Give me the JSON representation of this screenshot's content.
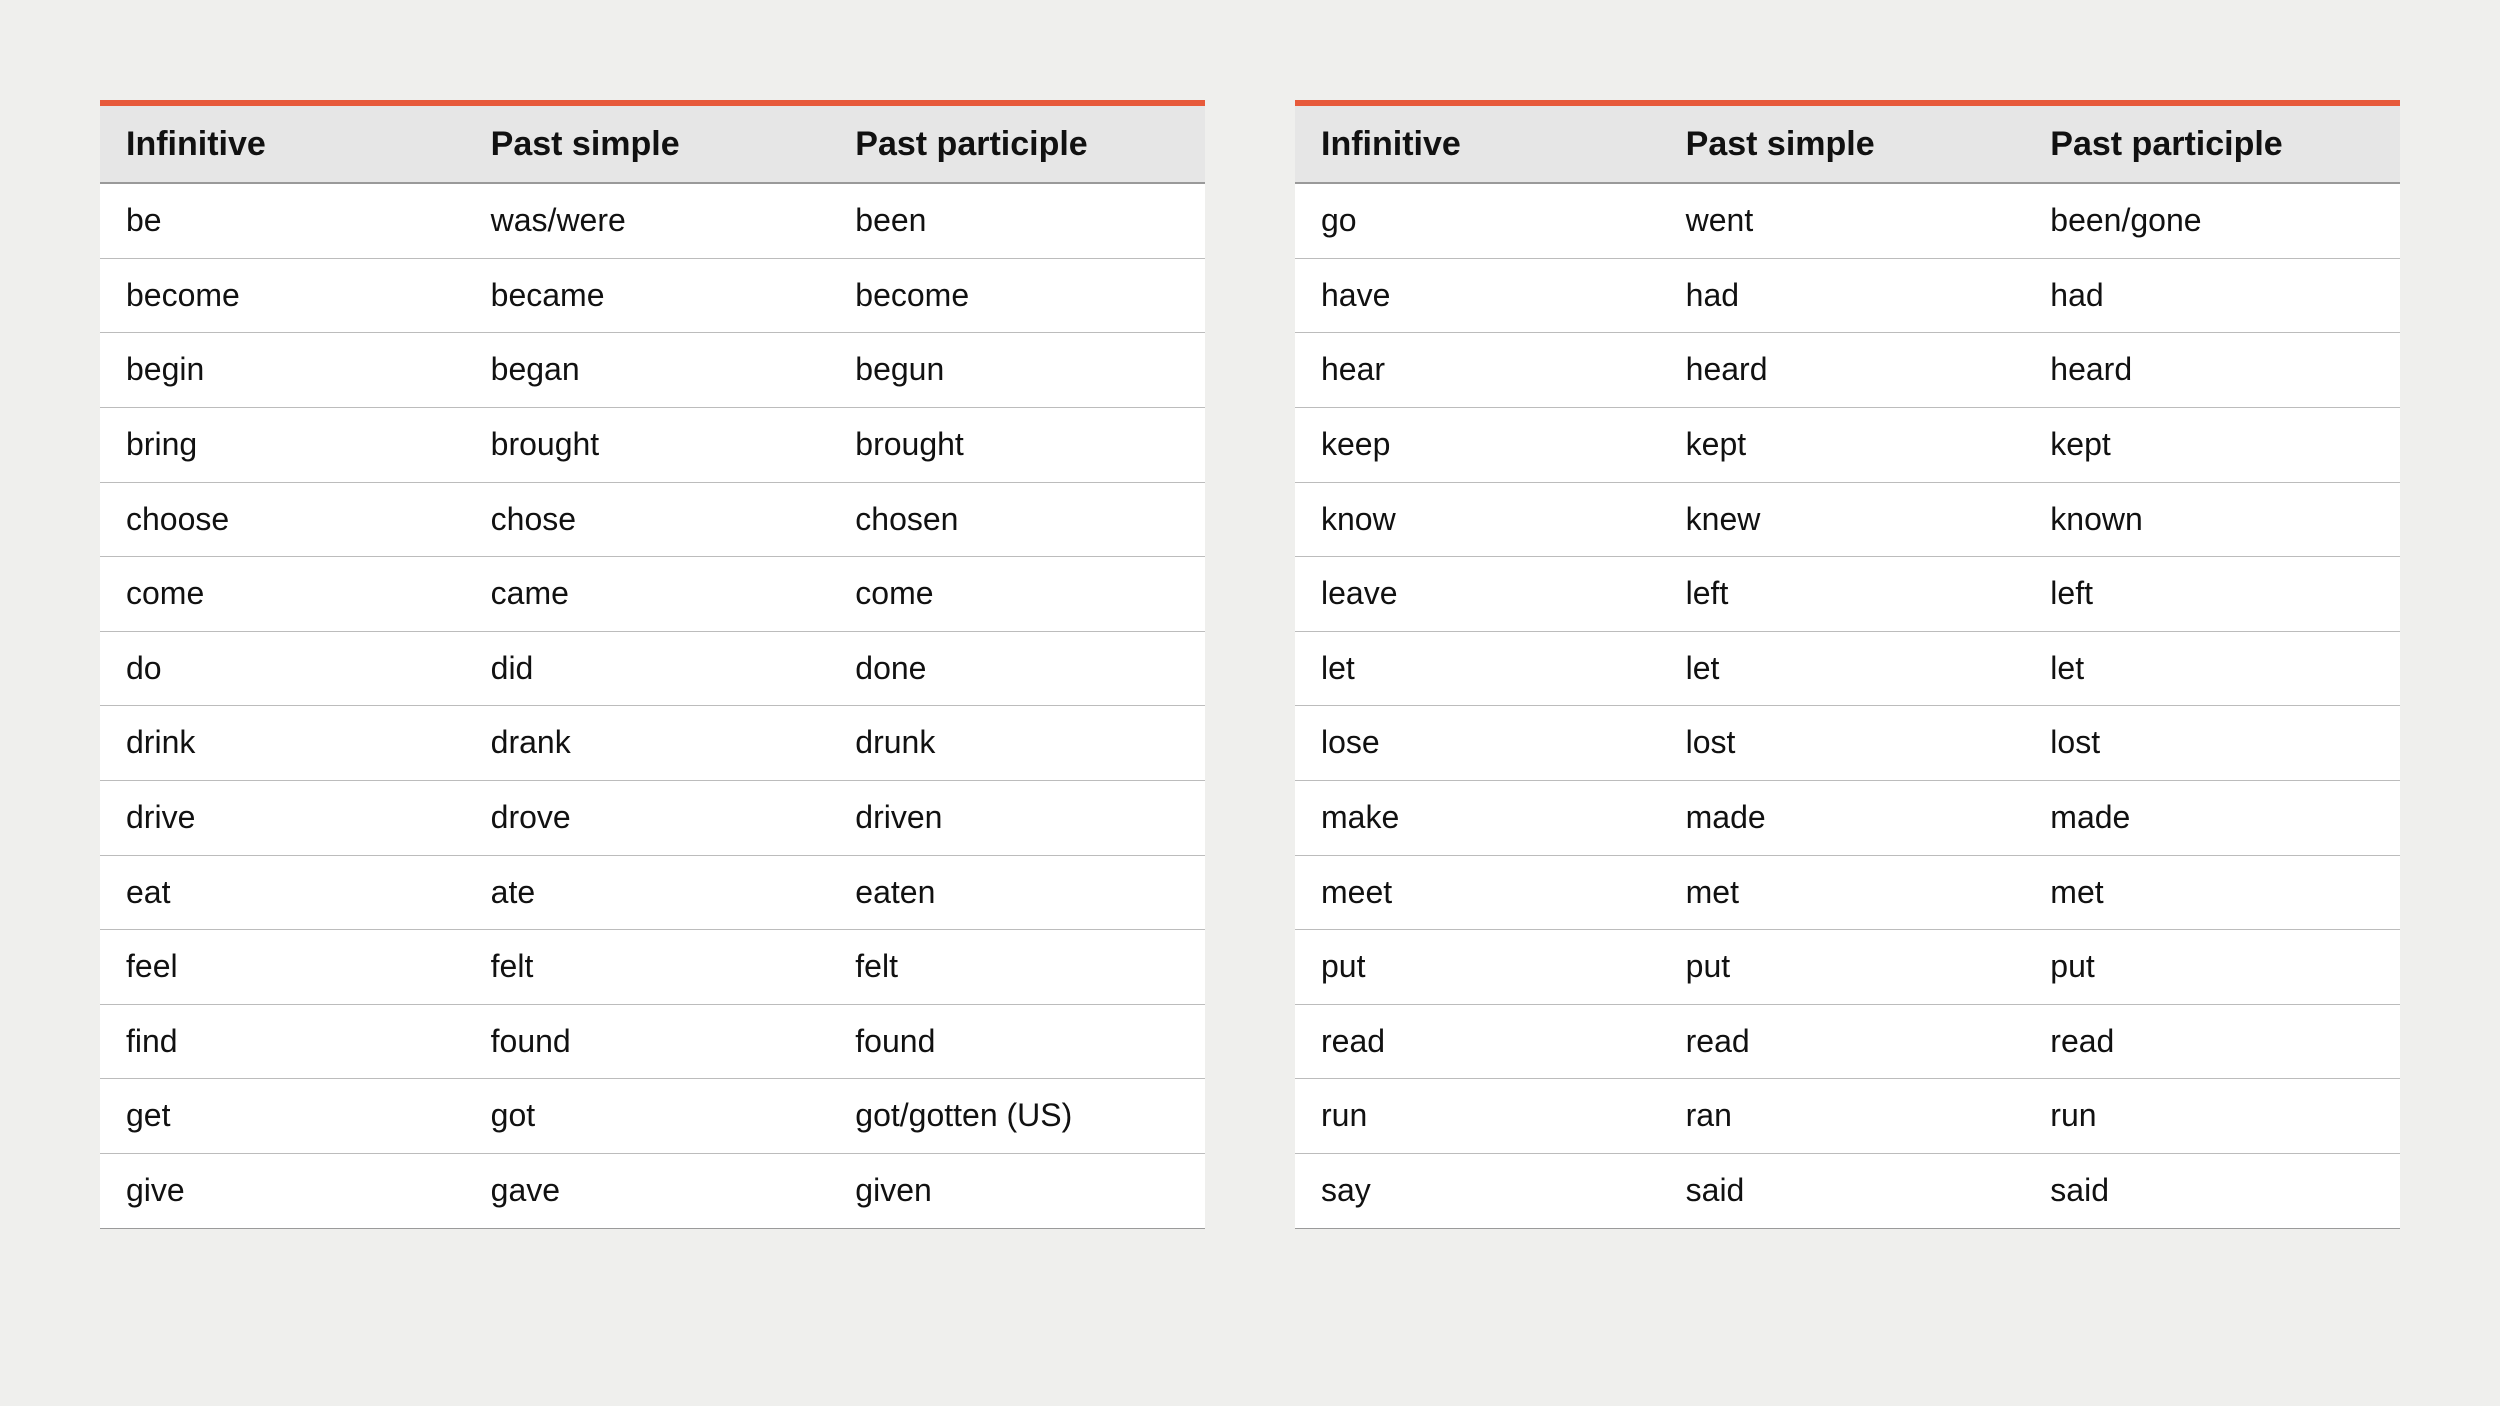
{
  "headers": {
    "infinitive": "Infinitive",
    "past_simple": "Past simple",
    "past_participle": "Past participle"
  },
  "tables": [
    {
      "rows": [
        {
          "infinitive": "be",
          "past_simple": "was/were",
          "past_participle": "been"
        },
        {
          "infinitive": "become",
          "past_simple": "became",
          "past_participle": "become"
        },
        {
          "infinitive": "begin",
          "past_simple": "began",
          "past_participle": "begun"
        },
        {
          "infinitive": "bring",
          "past_simple": "brought",
          "past_participle": "brought"
        },
        {
          "infinitive": "choose",
          "past_simple": "chose",
          "past_participle": "chosen"
        },
        {
          "infinitive": "come",
          "past_simple": "came",
          "past_participle": "come"
        },
        {
          "infinitive": "do",
          "past_simple": "did",
          "past_participle": "done"
        },
        {
          "infinitive": "drink",
          "past_simple": "drank",
          "past_participle": "drunk"
        },
        {
          "infinitive": "drive",
          "past_simple": "drove",
          "past_participle": "driven"
        },
        {
          "infinitive": "eat",
          "past_simple": "ate",
          "past_participle": "eaten"
        },
        {
          "infinitive": "feel",
          "past_simple": "felt",
          "past_participle": "felt"
        },
        {
          "infinitive": "find",
          "past_simple": "found",
          "past_participle": "found"
        },
        {
          "infinitive": "get",
          "past_simple": "got",
          "past_participle": "got/gotten (US)"
        },
        {
          "infinitive": "give",
          "past_simple": "gave",
          "past_participle": "given"
        }
      ]
    },
    {
      "rows": [
        {
          "infinitive": "go",
          "past_simple": "went",
          "past_participle": "been/gone"
        },
        {
          "infinitive": "have",
          "past_simple": "had",
          "past_participle": "had"
        },
        {
          "infinitive": "hear",
          "past_simple": "heard",
          "past_participle": "heard"
        },
        {
          "infinitive": "keep",
          "past_simple": "kept",
          "past_participle": "kept"
        },
        {
          "infinitive": "know",
          "past_simple": "knew",
          "past_participle": "known"
        },
        {
          "infinitive": "leave",
          "past_simple": "left",
          "past_participle": "left"
        },
        {
          "infinitive": "let",
          "past_simple": "let",
          "past_participle": "let"
        },
        {
          "infinitive": "lose",
          "past_simple": "lost",
          "past_participle": "lost"
        },
        {
          "infinitive": "make",
          "past_simple": "made",
          "past_participle": "made"
        },
        {
          "infinitive": "meet",
          "past_simple": "met",
          "past_participle": "met"
        },
        {
          "infinitive": "put",
          "past_simple": "put",
          "past_participle": "put"
        },
        {
          "infinitive": "read",
          "past_simple": "read",
          "past_participle": "read"
        },
        {
          "infinitive": "run",
          "past_simple": "ran",
          "past_participle": "run"
        },
        {
          "infinitive": "say",
          "past_simple": "said",
          "past_participle": "said"
        }
      ]
    }
  ]
}
